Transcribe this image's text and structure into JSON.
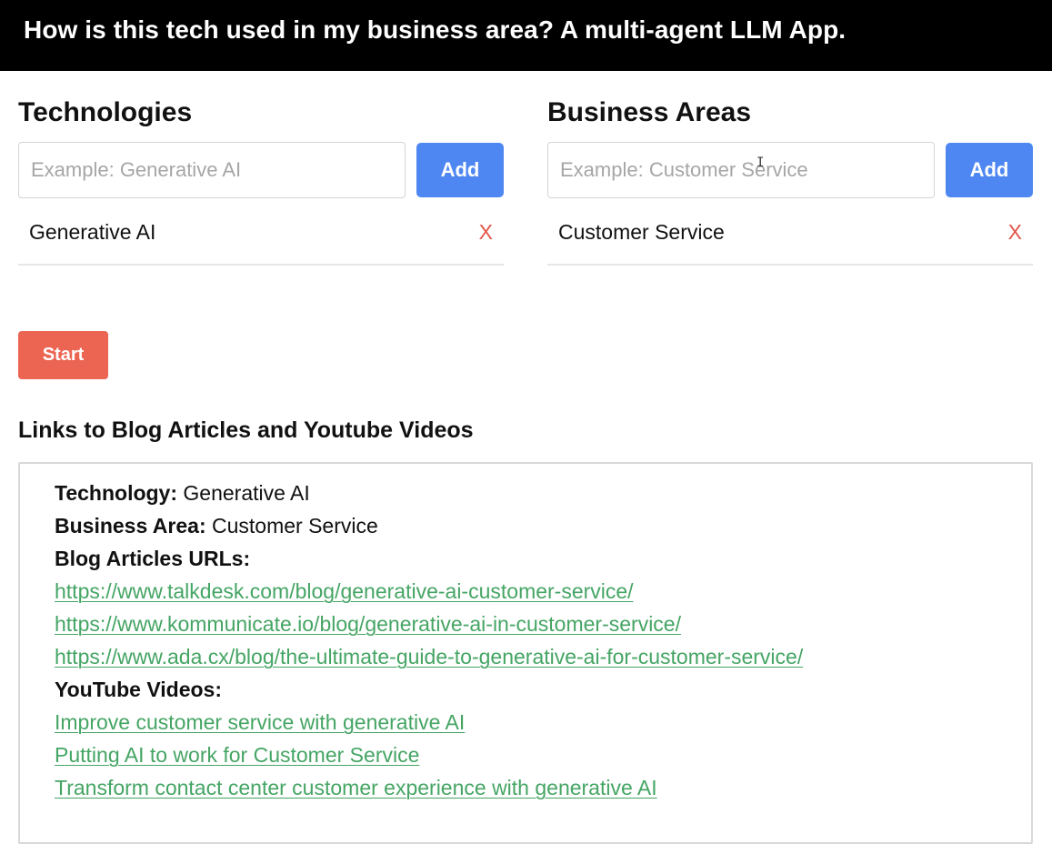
{
  "header": {
    "title": "How is this tech used in my business area? A multi-agent LLM App."
  },
  "technologies": {
    "heading": "Technologies",
    "placeholder": "Example: Generative AI",
    "add_label": "Add",
    "items": [
      {
        "label": "Generative AI",
        "remove": "X"
      }
    ]
  },
  "business_areas": {
    "heading": "Business Areas",
    "placeholder": "Example: Customer Service",
    "add_label": "Add",
    "items": [
      {
        "label": "Customer Service",
        "remove": "X"
      }
    ]
  },
  "start_label": "Start",
  "results": {
    "heading": "Links to Blog Articles and Youtube Videos",
    "technology_label": "Technology:",
    "technology_value": "Generative AI",
    "business_area_label": "Business Area:",
    "business_area_value": "Customer Service",
    "blog_label": "Blog Articles URLs:",
    "blog_urls": [
      "https://www.talkdesk.com/blog/generative-ai-customer-service/",
      "https://www.kommunicate.io/blog/generative-ai-in-customer-service/",
      "https://www.ada.cx/blog/the-ultimate-guide-to-generative-ai-for-customer-service/"
    ],
    "youtube_label": "YouTube Videos:",
    "youtube_videos": [
      "Improve customer service with generative AI",
      "Putting AI to work for Customer Service",
      "Transform contact center customer experience with generative AI"
    ]
  },
  "colors": {
    "header_bg": "#000000",
    "add_button": "#4f87f2",
    "start_button": "#ec6552",
    "remove_x": "#e2564a",
    "link": "#45a564"
  }
}
